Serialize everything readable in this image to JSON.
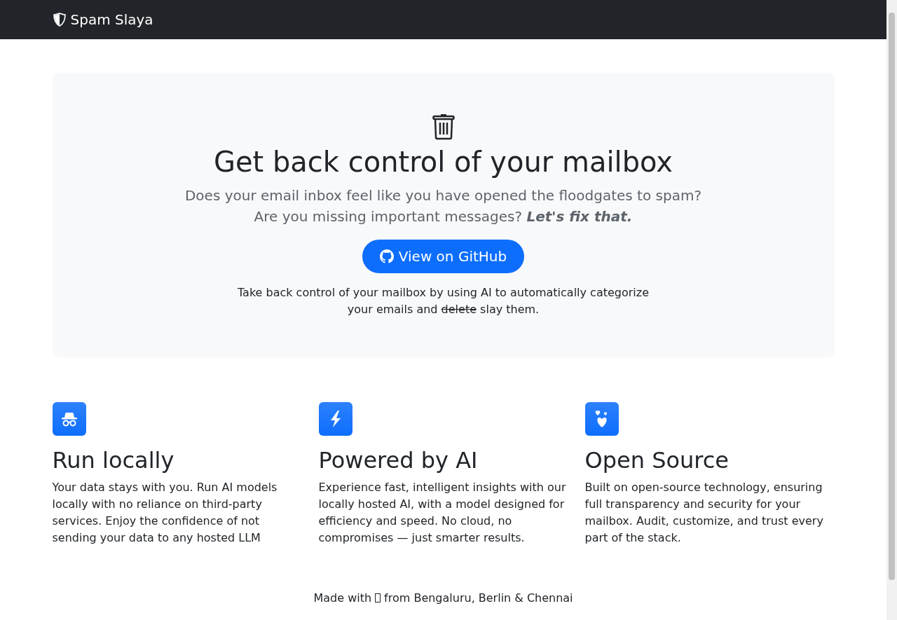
{
  "navbar": {
    "brand": "Spam Slaya"
  },
  "hero": {
    "title": "Get back control of your mailbox",
    "lead": [
      "Does your email inbox feel like you have opened the floodgates to spam?",
      "Are you missing important messages? **Let's fix that.**"
    ],
    "button": "View on GitHub",
    "description": {
      "before": "Take back control of your mailbox by using AI to automatically categorize your emails and",
      "struck": "delete",
      "after": "slay them."
    }
  },
  "features": [
    {
      "kind": "incognito",
      "title": "Run locally",
      "text": "Your data stays with you. Run AI models locally with no reliance on third-party services. Enjoy the confidence of not sending your data to any hosted LLM"
    },
    {
      "kind": "lightning",
      "title": "Powered by AI",
      "text": "Experience fast, intelligent insights with our locally hosted AI, with a model designed for efficiency and speed. No cloud, no compromises — just smarter results."
    },
    {
      "kind": "hearts",
      "title": "Open Source",
      "text": "Built on open-source technology, ensuring full transparency and security for your mailbox. Audit, customize, and trust every part of the stack."
    }
  ],
  "footer": {
    "before": "Made with",
    "after": "from Bengaluru, Berlin & Chennai"
  }
}
